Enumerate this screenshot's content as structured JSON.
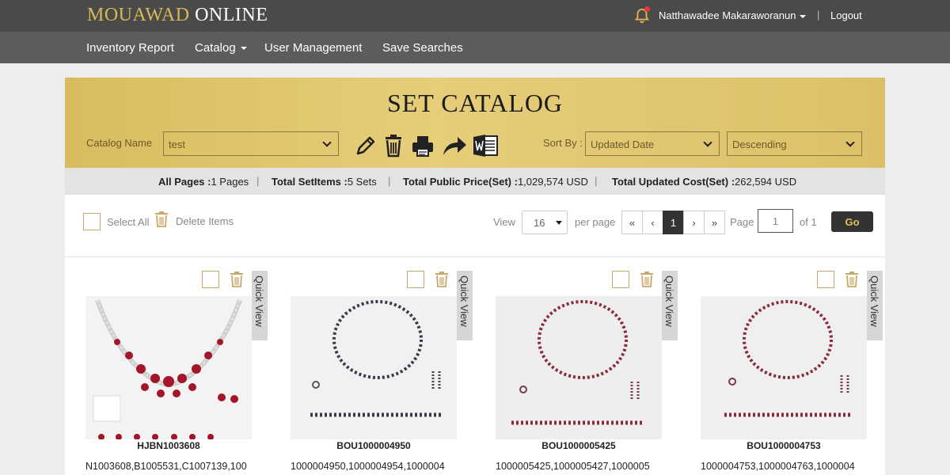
{
  "brand": {
    "part1": "MOUAWAD",
    "part2": "ONLINE"
  },
  "user": {
    "name": "Natthawadee Makaraworanun",
    "logout": "Logout",
    "separator": "|"
  },
  "nav": {
    "items": [
      "Inventory Report",
      "Catalog",
      "User Management",
      "Save Searches"
    ]
  },
  "header": {
    "title": "SET CATALOG",
    "catalog_label": "Catalog Name",
    "catalog_value": "test",
    "sort_label": "Sort By :",
    "sort_value": "Updated Date",
    "order_value": "Descending"
  },
  "stats": {
    "pages_label": "All Pages :",
    "pages_value": "1 Pages",
    "set_items_label": "Total SetItems :",
    "set_items_value": "5 Sets",
    "public_price_label": "Total Public Price(Set) :",
    "public_price_value": "1,029,574 USD",
    "updated_cost_label": "Total Updated Cost(Set) :",
    "updated_cost_value": "262,594 USD",
    "separator": "|"
  },
  "controls": {
    "select_all": "Select All",
    "delete_items": "Delete Items",
    "view_label": "View",
    "view_value": "16",
    "per_page": "per page",
    "pager": [
      "«",
      "‹",
      "1",
      "›",
      "»"
    ],
    "page_label": "Page",
    "page_value": "1",
    "of_label": "of 1",
    "go": "Go"
  },
  "quick_view": "Quick View",
  "products": [
    {
      "code": "HJBN1003608",
      "items": "N1003608,B1005531,C1007139,100"
    },
    {
      "code": "BOU1000004950",
      "items": "1000004950,1000004954,1000004"
    },
    {
      "code": "BOU1000005425",
      "items": "1000005425,1000005427,1000005"
    },
    {
      "code": "BOU1000004753",
      "items": "1000004753,1000004763,1000004"
    }
  ],
  "colors": {
    "gold": "#d7b955",
    "dark": "#333333",
    "ruby": "#a3162a"
  }
}
